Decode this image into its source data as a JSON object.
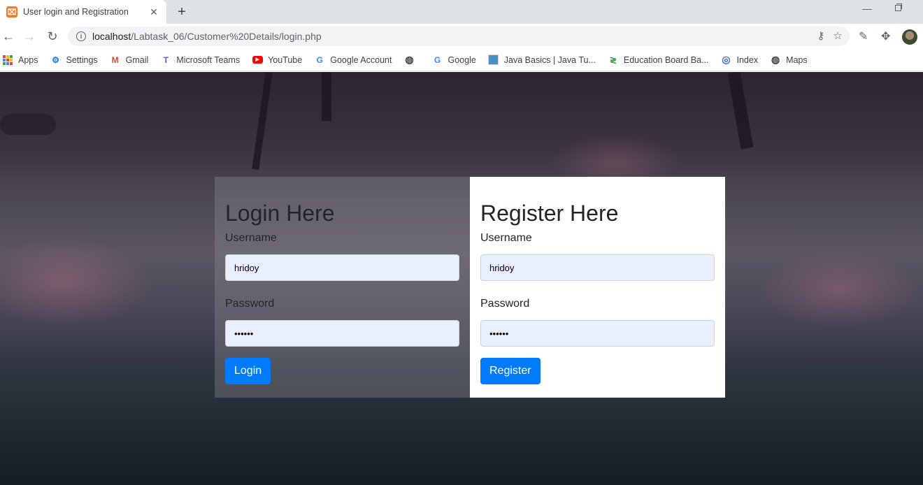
{
  "browser": {
    "tab_title": "User login and Registration",
    "tab_favicon": "⌧",
    "new_tab": "+",
    "minimize": "—",
    "url_host": "localhost",
    "url_path": "/Labtask_06/Customer%20Details/login.php"
  },
  "bookmarks": [
    {
      "label": "Apps",
      "icon": "apps-grid"
    },
    {
      "label": "Settings",
      "icon": "gear"
    },
    {
      "label": "Gmail",
      "icon": "gmail"
    },
    {
      "label": "Microsoft Teams",
      "icon": "teams"
    },
    {
      "label": "YouTube",
      "icon": "youtube"
    },
    {
      "label": "Google Account",
      "icon": "google"
    },
    {
      "label": "",
      "icon": "globe"
    },
    {
      "label": "Google",
      "icon": "google"
    },
    {
      "label": "Java Basics | Java Tu...",
      "icon": "java"
    },
    {
      "label": "Education Board Ba...",
      "icon": "edu"
    },
    {
      "label": "Index",
      "icon": "index"
    },
    {
      "label": "Maps",
      "icon": "globe"
    }
  ],
  "login": {
    "title": "Login Here",
    "username_label": "Username",
    "username_value": "hridoy",
    "password_label": "Password",
    "password_value": "••••••",
    "button": "Login"
  },
  "register": {
    "title": "Register Here",
    "username_label": "Username",
    "username_value": "hridoy",
    "password_label": "Password",
    "password_value": "••••••",
    "button": "Register"
  },
  "colors": {
    "primary": "#007bff",
    "autofill": "#e8f0fe"
  }
}
